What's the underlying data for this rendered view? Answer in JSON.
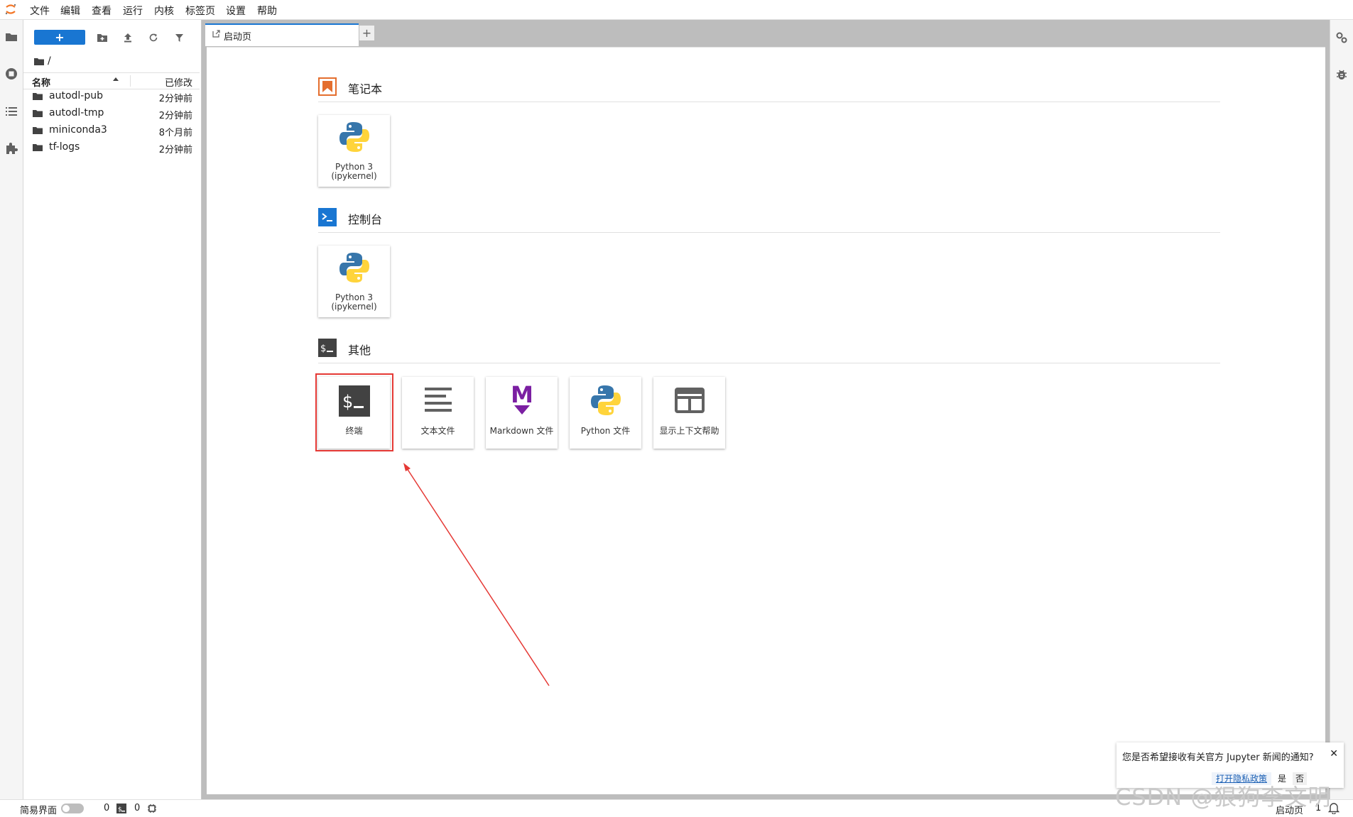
{
  "menubar": {
    "logo_icon": "jupyter-logo-icon",
    "items": [
      "文件",
      "编辑",
      "查看",
      "运行",
      "内核",
      "标签页",
      "设置",
      "帮助"
    ]
  },
  "leftbar": {
    "icons": [
      "folder-icon",
      "running-icon",
      "toc-icon",
      "extension-icon"
    ]
  },
  "filebrowser": {
    "new_button": "+",
    "toolbar_icons": [
      "new-folder-icon",
      "upload-icon",
      "refresh-icon",
      "filter-icon"
    ],
    "breadcrumb": "/",
    "col_name": "名称",
    "col_modified": "已修改",
    "files": [
      {
        "name": "autodl-pub",
        "modified": "2分钟前"
      },
      {
        "name": "autodl-tmp",
        "modified": "2分钟前"
      },
      {
        "name": "miniconda3",
        "modified": "8个月前"
      },
      {
        "name": "tf-logs",
        "modified": "2分钟前"
      }
    ]
  },
  "tabs": {
    "launcher_label": "启动页",
    "add_label": "+"
  },
  "launcher": {
    "sections": [
      {
        "title": "笔记本",
        "cards": [
          {
            "line1": "Python 3",
            "line2": "(ipykernel)"
          }
        ]
      },
      {
        "title": "控制台",
        "cards": [
          {
            "line1": "Python 3",
            "line2": "(ipykernel)"
          }
        ]
      },
      {
        "title": "其他",
        "cards": [
          {
            "label": "终端"
          },
          {
            "label": "文本文件"
          },
          {
            "label": "Markdown 文件"
          },
          {
            "label": "Python 文件"
          },
          {
            "label": "显示上下文帮助"
          }
        ]
      }
    ],
    "highlight_color": "#e53935"
  },
  "rightbar": {
    "icons": [
      "property-inspector-icon",
      "debugger-icon"
    ]
  },
  "notification": {
    "message": "您是否希望接收有关官方 Jupyter 新闻的通知?",
    "privacy": "打开隐私政策",
    "yes": "是",
    "no": "否",
    "close": "✕"
  },
  "statusbar": {
    "simple_mode": "简易界面",
    "terminals_count": "0",
    "kernels_count": "0",
    "tab_label": "启动页",
    "tab_count": "1"
  },
  "watermark": "CSDN @狠狗李文明",
  "colors": {
    "accent": "#1976d2",
    "notebook_orange": "#e46e2e",
    "console_blue": "#1976d2",
    "markdown_purple": "#7b1fa2"
  }
}
